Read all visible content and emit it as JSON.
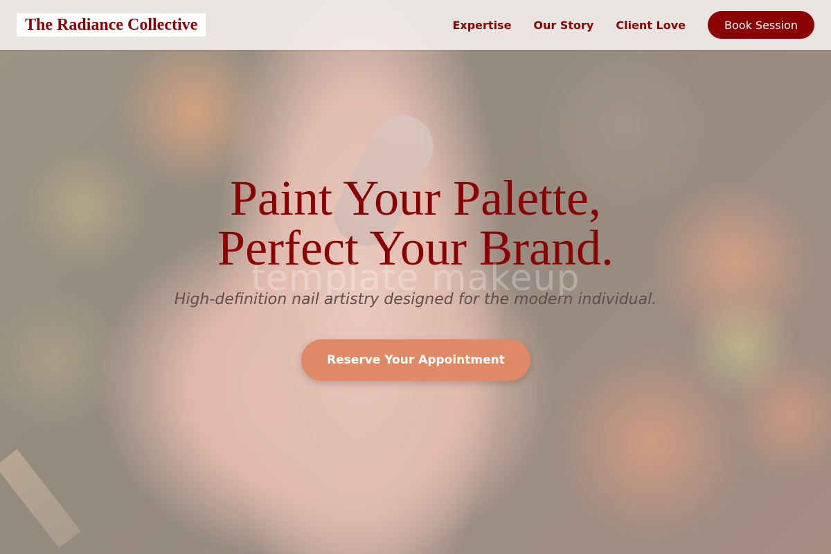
{
  "header": {
    "brand": "The Radiance Collective",
    "nav": {
      "expertise": "Expertise",
      "our_story": "Our Story",
      "client_love": "Client Love"
    },
    "book_label": "Book Session"
  },
  "hero": {
    "headline_line1": "Paint Your Palette,",
    "headline_line2": "Perfect Your Brand.",
    "watermark": "template makeup",
    "subheadline": "High-definition nail artistry designed for the modern individual.",
    "cta_label": "Reserve Your Appointment"
  },
  "colors": {
    "brand": "#8b0000",
    "cta": "#e08966",
    "header_bg": "#f4f0ee"
  }
}
